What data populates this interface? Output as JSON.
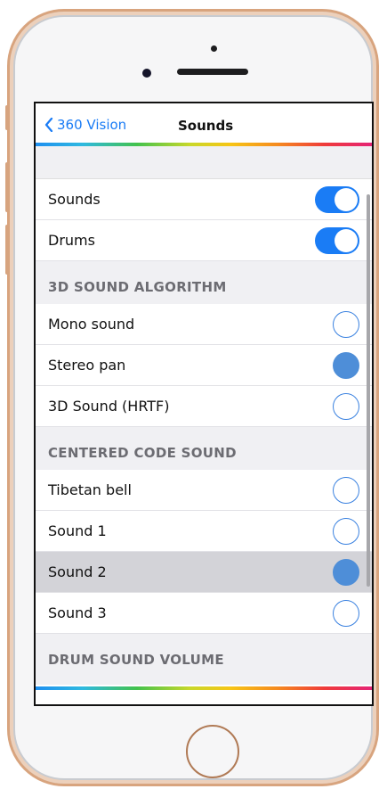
{
  "nav": {
    "back_label": "360 Vision",
    "title": "Sounds"
  },
  "toggles": [
    {
      "label": "Sounds",
      "on": true
    },
    {
      "label": "Drums",
      "on": true
    }
  ],
  "sections": {
    "algorithm": {
      "header": "3D SOUND ALGORITHM",
      "items": [
        {
          "label": "Mono sound",
          "selected": false
        },
        {
          "label": "Stereo pan",
          "selected": true
        },
        {
          "label": "3D Sound (HRTF)",
          "selected": false
        }
      ]
    },
    "centered": {
      "header": "CENTERED CODE SOUND",
      "items": [
        {
          "label": "Tibetan bell",
          "selected": false
        },
        {
          "label": "Sound 1",
          "selected": false
        },
        {
          "label": "Sound 2",
          "selected": true
        },
        {
          "label": "Sound 3",
          "selected": false
        }
      ]
    },
    "drum_volume": {
      "header": "DRUM SOUND VOLUME"
    }
  },
  "colors": {
    "accent": "#1a7cf5",
    "radio_fill": "#4e8ed8",
    "section_header": "#6c6c72",
    "selected_row": "#d3d3d8",
    "frame": "#d8a47e"
  },
  "icons": {
    "back": "chevron-left-icon"
  }
}
